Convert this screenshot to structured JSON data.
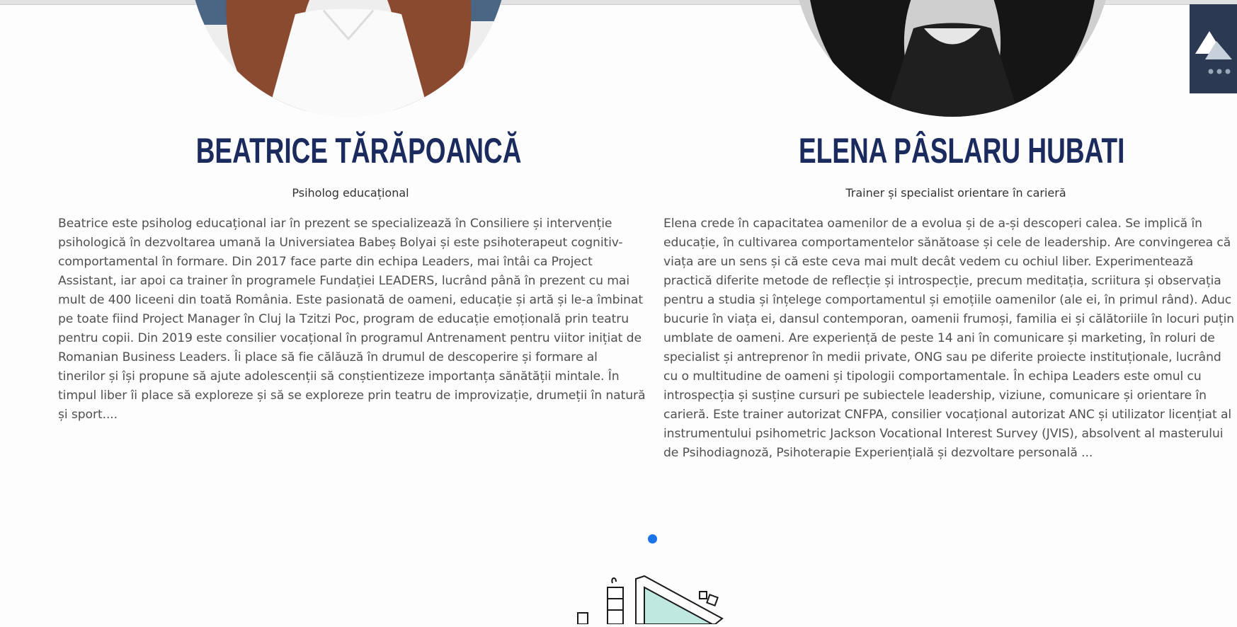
{
  "people": [
    {
      "name": "BEATRICE TĂRĂPOANCĂ",
      "role": "Psiholog educațional",
      "bio": "Beatrice este psiholog educațional iar în prezent se specializează în Consiliere și intervenție psihologică în dezvoltarea umană la Universiatea Babeș Bolyai și este psihoterapeut cognitiv-comportamental în formare. Din 2017 face parte din echipa Leaders, mai întâi ca Project Assistant, iar apoi ca trainer în programele Fundației LEADERS, lucrând până în prezent cu mai mult de 400 liceeni din toată România. Este pasionată de oameni, educație și artă și le-a îmbinat pe toate fiind Project Manager în Cluj la Tzitzi Poc, program de educație emoțională prin teatru pentru copii. Din 2019 este consilier vocațional în programul Antrenament pentru viitor inițiat de Romanian Business Leaders. Îi place să fie călăuză în drumul de descoperire și formare al tinerilor și își propune să ajute adolescenții să conștientizeze importanța sănătății mintale. În timpul liber îi place să exploreze și să se exploreze prin teatru de improvizație, drumeții în natură și sport...."
    },
    {
      "name": "ELENA PÂSLARU HUBATI",
      "role": "Trainer și specialist orientare în carieră",
      "bio": "Elena crede în capacitatea oamenilor de a evolua și de a-și descoperi calea. Se implică în educație, în cultivarea comportamentelor sănătoase și cele de leadership. Are convingerea că viața are un sens și că este ceva mai mult decât vedem cu ochiul liber. Experimentează practică diferite metode de reflecție și introspecție, precum meditația, scriitura și observația pentru a studia și înțelege comportamentul și emoțiile oamenilor (ale ei, în primul rând). Aduc bucurie în viața ei, dansul contemporan, oamenii frumoși, familia ei și călătoriile în locuri puțin umblate de oameni. Are experiență de peste 14 ani în comunicare și marketing, în roluri de specialist și antreprenor în medii private, ONG sau pe diferite proiecte instituționale, lucrând cu o multitudine de oameni și tipologii comportamentale. În echipa Leaders este omul cu introspecția și susține cursuri pe subiectele leadership, viziune, comunicare și orientare în carieră. Este trainer autorizat CNFPA, consilier vocațional autorizat ANC și utilizator licențiat al instrumentului psihometric Jackson Vocational Interest Survey (JVIS), absolvent al masterului de Psihodiagnoză, Psihoterapie Experiențială și dezvoltare personală ..."
    }
  ],
  "carousel": {
    "active_index": 0,
    "dot_color": "#1a73e8"
  },
  "colors": {
    "name": "#1b2b5e",
    "body_text": "#505050",
    "widget_bg": "#2b3a52"
  },
  "icons": [
    "logo-triangle-icon",
    "more-dots-icon"
  ]
}
